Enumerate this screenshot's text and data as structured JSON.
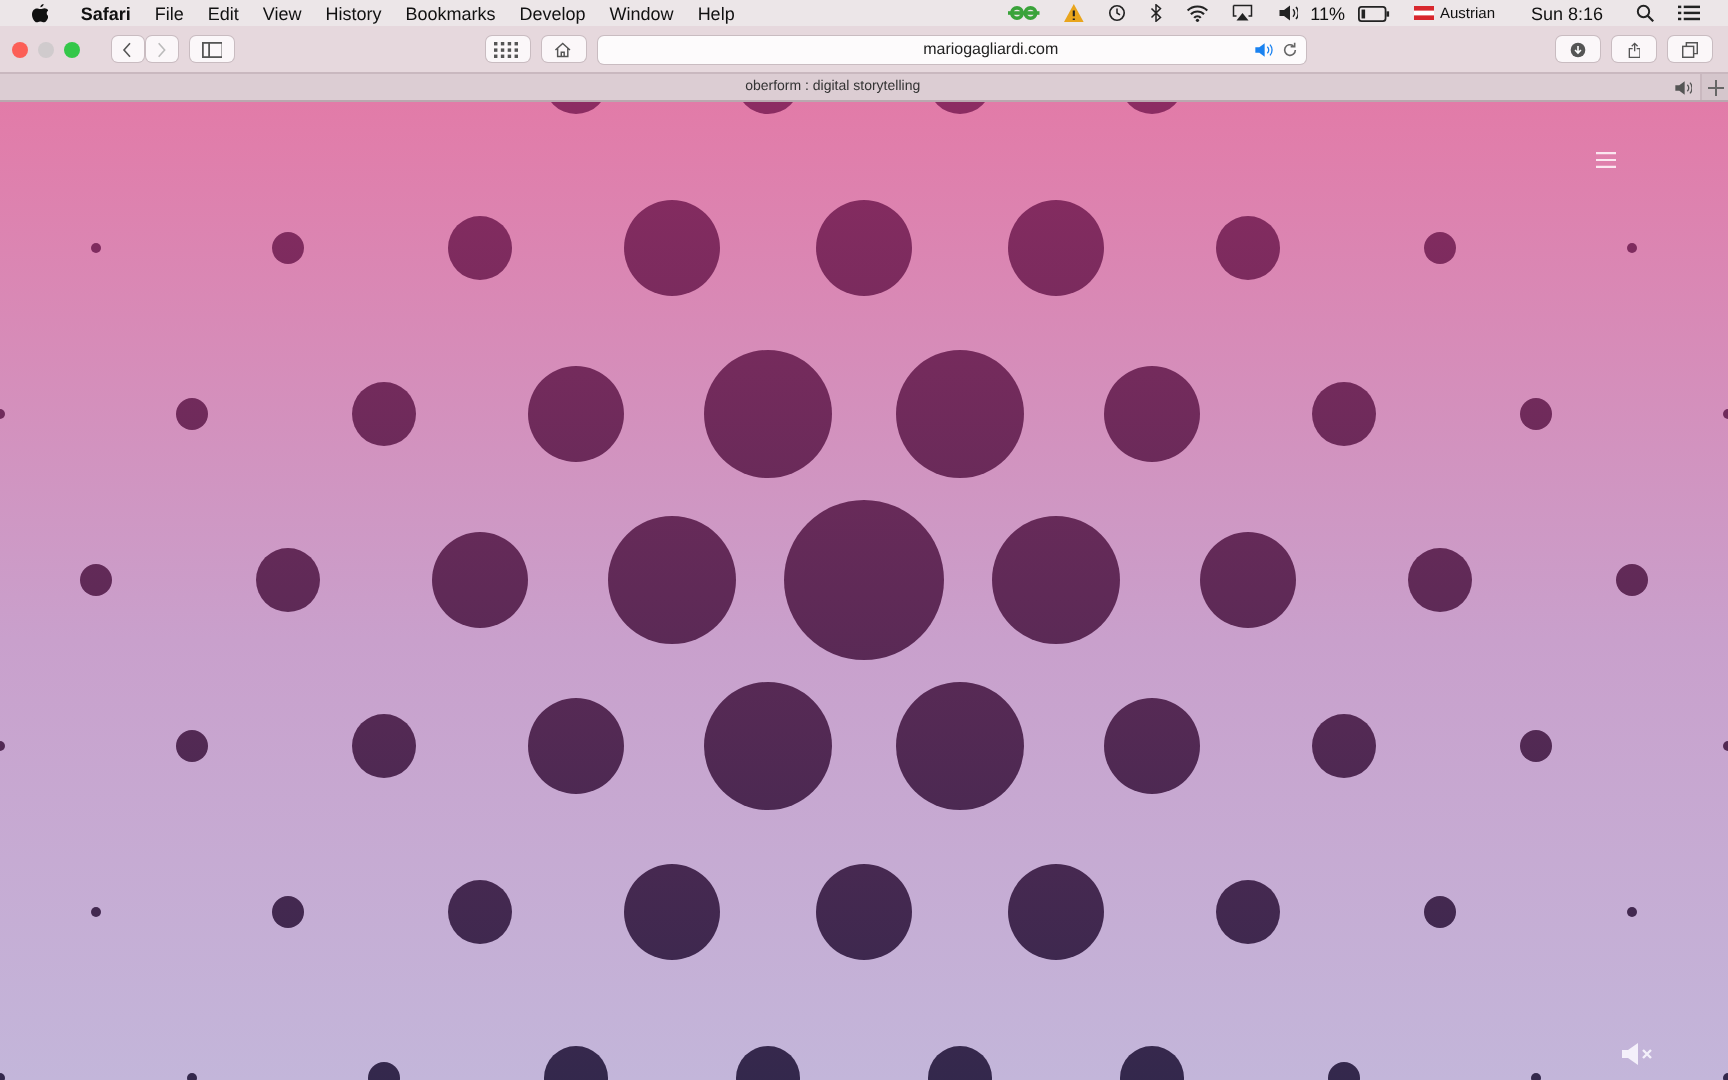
{
  "menu_bar": {
    "app_name": "Safari",
    "items": [
      "File",
      "Edit",
      "View",
      "History",
      "Bookmarks",
      "Develop",
      "Window",
      "Help"
    ],
    "battery": "11%",
    "input_source": "Austrian",
    "clock": "Sun 8:16"
  },
  "toolbar": {
    "url": "mariogagliardi.com"
  },
  "tab": {
    "title": "oberform : digital storytelling"
  }
}
